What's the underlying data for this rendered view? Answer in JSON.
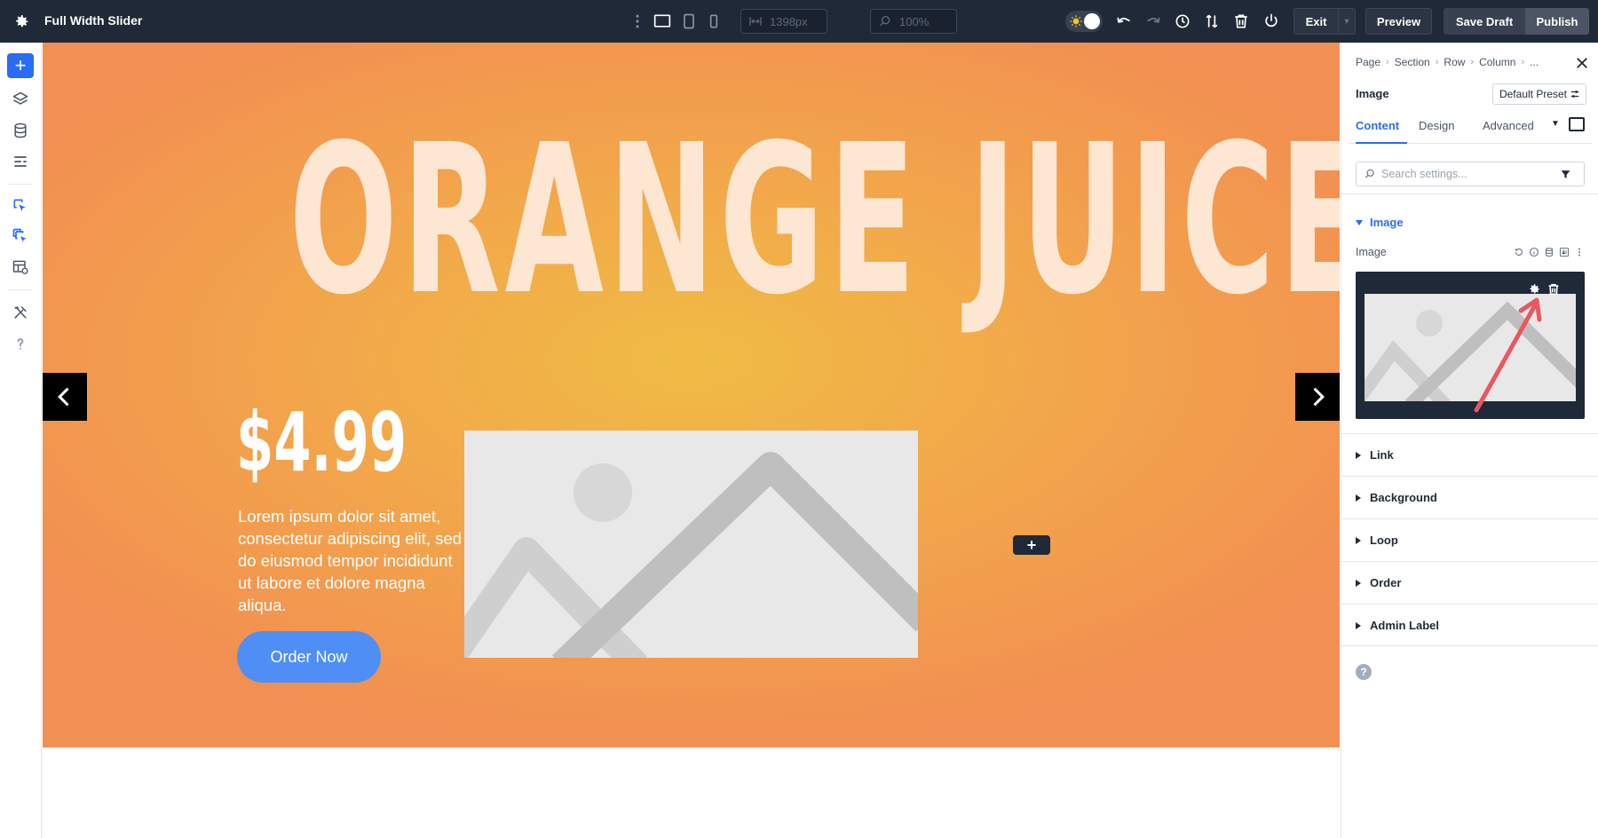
{
  "topbar": {
    "page_title": "Full Width Slider",
    "width_value": "1398px",
    "zoom_value": "100%",
    "exit_label": "Exit",
    "preview_label": "Preview",
    "save_draft_label": "Save Draft",
    "publish_label": "Publish",
    "icons": [
      "gear-icon",
      "more-vertical-icon",
      "desktop-icon",
      "tablet-icon",
      "phone-icon",
      "width-icon",
      "zoom-icon",
      "theme-toggle",
      "undo-icon",
      "redo-icon",
      "history-icon",
      "sort-icon",
      "trash-icon",
      "power-icon"
    ]
  },
  "leftbar": {
    "add_label": "+",
    "icons": [
      "add-icon",
      "layers-icon",
      "database-icon",
      "list-icon",
      "pointer-icon",
      "multi-pointer-icon",
      "layout-settings-icon",
      "tools-icon",
      "help-icon"
    ]
  },
  "canvas": {
    "title": "ORANGE JUICE",
    "price": "$4.99",
    "description": "Lorem ipsum dolor sit amet, consectetur adipiscing elit, sed do eiusmod tempor incididunt ut labore et dolore magna aliqua.",
    "order_button": "Order Now",
    "add_module_label": "+",
    "colors": {
      "gradient_center": "#f0bb45",
      "gradient_edge": "#f28f52",
      "title_color": "#fde7d3",
      "button_color": "#4f8ef5"
    }
  },
  "panel": {
    "breadcrumb": [
      "Page",
      "Section",
      "Row",
      "Column",
      "..."
    ],
    "module_title": "Image",
    "preset_label": "Default Preset",
    "tabs": [
      {
        "label": "Content",
        "active": true
      },
      {
        "label": "Design",
        "active": false
      },
      {
        "label": "Advanced",
        "active": false
      }
    ],
    "search_placeholder": "Search settings...",
    "image_group": {
      "title": "Image",
      "field_label": "Image"
    },
    "groups": [
      "Link",
      "Background",
      "Loop",
      "Order",
      "Admin Label"
    ],
    "accent_color": "#2b6cf6"
  }
}
